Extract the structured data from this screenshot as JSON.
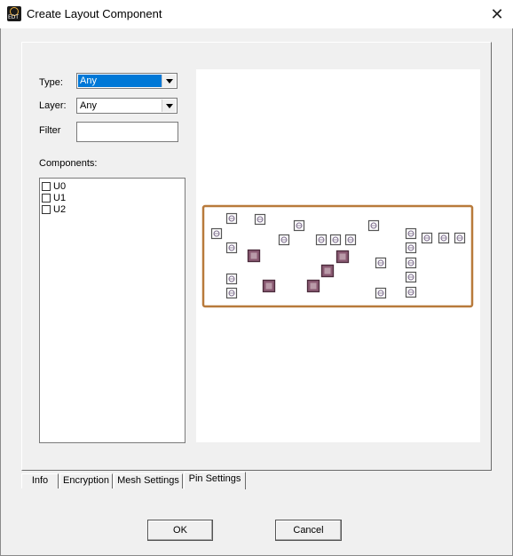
{
  "window": {
    "title": "Create Layout Component",
    "close_glyph": "✕",
    "icon_text": "EDT"
  },
  "form": {
    "type_label": "Type:",
    "type_value": "Any",
    "layer_label": "Layer:",
    "layer_value": "Any",
    "filter_label": "Filter",
    "filter_value": "",
    "components_label": "Components:"
  },
  "components": [
    {
      "label": "U0",
      "checked": false
    },
    {
      "label": "U1",
      "checked": false
    },
    {
      "label": "U2",
      "checked": false
    }
  ],
  "tabs": [
    {
      "label": "Info",
      "active": false
    },
    {
      "label": "Encryption",
      "active": false
    },
    {
      "label": "Mesh Settings",
      "active": false
    },
    {
      "label": "Pin Settings",
      "active": true
    }
  ],
  "buttons": {
    "ok": "OK",
    "cancel": "Cancel"
  },
  "colors": {
    "board_outline": "#b87a3b",
    "pin_stroke": "#555555",
    "pad_fill": "#8a5a72",
    "selection": "#0078d7"
  }
}
